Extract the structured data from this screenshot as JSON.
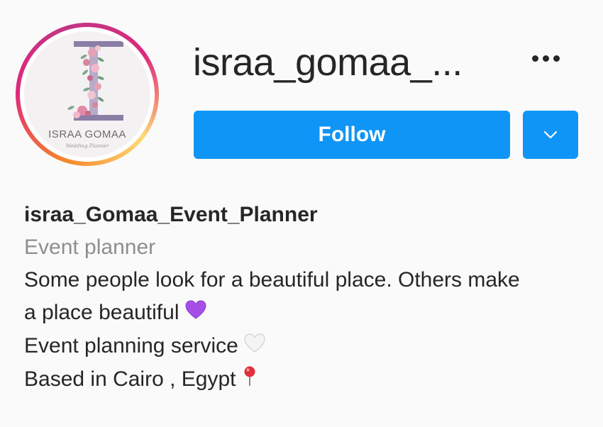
{
  "profile": {
    "username": "israa_gomaa_...",
    "avatar": {
      "name": "ISRAA GOMAA",
      "subtitle": "Wedding Planner",
      "letter": "I"
    },
    "follow_label": "Follow",
    "more_icon": "more-horizontal-icon",
    "dropdown_icon": "chevron-down-icon"
  },
  "bio": {
    "full_name": "israa_Gomaa_Event_Planner",
    "category": "Event planner",
    "line1": "Some people look for a beautiful place. Others make",
    "line2": "a place beautiful",
    "line2_emoji": "purple-heart-icon",
    "line3": "Event planning service",
    "line3_emoji": "white-heart-icon",
    "line4": "Based in Cairo , Egypt",
    "line4_emoji": "round-pushpin-icon"
  },
  "colors": {
    "accent": "#0f95f5",
    "text": "#262626",
    "muted": "#8e8e8e",
    "background": "#fafafa"
  }
}
